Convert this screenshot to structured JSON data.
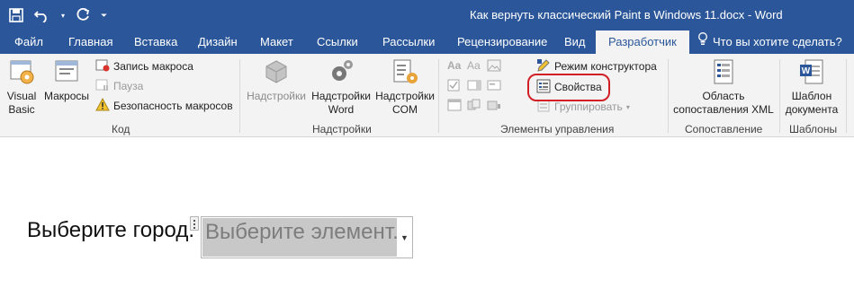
{
  "window": {
    "title": "Как вернуть классический Paint в Windows 11.docx - Word"
  },
  "tabs": [
    {
      "label": "Файл"
    },
    {
      "label": "Главная"
    },
    {
      "label": "Вставка"
    },
    {
      "label": "Дизайн"
    },
    {
      "label": "Макет"
    },
    {
      "label": "Ссылки"
    },
    {
      "label": "Рассылки"
    },
    {
      "label": "Рецензирование"
    },
    {
      "label": "Вид"
    },
    {
      "label": "Разработчик"
    }
  ],
  "tell_me": "Что вы хотите сделать?",
  "groups": {
    "code": {
      "label": "Код",
      "visual_basic": [
        "Visual",
        "Basic"
      ],
      "macros": "Макросы",
      "record_macro": "Запись макроса",
      "pause": "Пауза",
      "macro_security": "Безопасность макросов"
    },
    "addins": {
      "label": "Надстройки",
      "addins": "Надстройки",
      "word_addins": [
        "Надстройки",
        "Word"
      ],
      "com_addins": [
        "Надстройки",
        "COM"
      ]
    },
    "controls": {
      "label": "Элементы управления",
      "design_mode": "Режим конструктора",
      "properties": "Свойства",
      "group": "Группировать"
    },
    "mapping": {
      "label": "Сопоставление",
      "xml_mapping": [
        "Область",
        "сопоставления XML"
      ]
    },
    "templates": {
      "label": "Шаблоны",
      "doc_template": [
        "Шаблон",
        "документа"
      ]
    }
  },
  "document": {
    "label_text": "Выберите город.",
    "content_control_placeholder": "Выберите элемент."
  },
  "colors": {
    "ribbon_blue": "#2b579a",
    "highlight": "#d21f26"
  }
}
